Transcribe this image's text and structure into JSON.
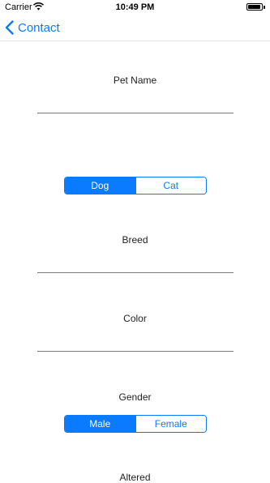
{
  "status_bar": {
    "carrier": "Carrier",
    "time": "10:49 PM",
    "battery_level": 0.95
  },
  "nav": {
    "back_label": "Contact"
  },
  "form": {
    "pet_name": {
      "label": "Pet Name",
      "value": ""
    },
    "species": {
      "options": [
        "Dog",
        "Cat"
      ],
      "selected": "Dog"
    },
    "breed": {
      "label": "Breed",
      "value": ""
    },
    "color": {
      "label": "Color",
      "value": ""
    },
    "gender": {
      "label": "Gender",
      "options": [
        "Male",
        "Female"
      ],
      "selected": "Male"
    },
    "altered": {
      "label": "Altered"
    }
  },
  "colors": {
    "accent": "#0a7aff",
    "separator": "#7a7a7a"
  }
}
